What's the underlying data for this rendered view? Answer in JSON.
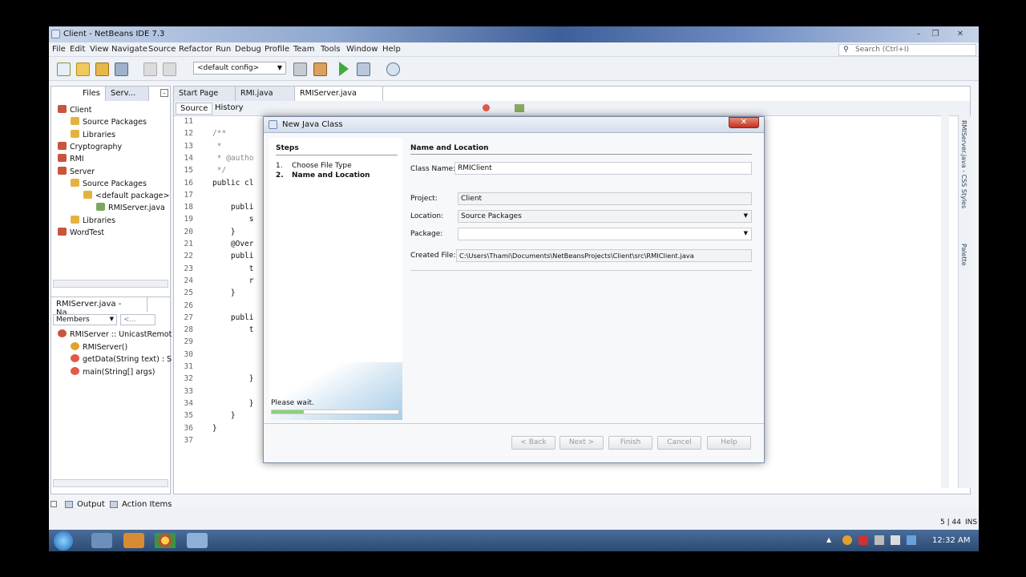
{
  "window": {
    "title": "Client - NetBeans IDE 7.3",
    "search_placeholder": "Search (Ctrl+I)"
  },
  "menu": [
    "File",
    "Edit",
    "View",
    "Navigate",
    "Source",
    "Refactor",
    "Run",
    "Debug",
    "Profile",
    "Team",
    "Tools",
    "Window",
    "Help"
  ],
  "toolbar": {
    "config": "<default config>"
  },
  "projects_panel": {
    "tabs": [
      "Files",
      "Serv..."
    ],
    "tree": [
      {
        "label": "Client",
        "depth": 0
      },
      {
        "label": "Source Packages",
        "depth": 1
      },
      {
        "label": "Libraries",
        "depth": 1
      },
      {
        "label": "Cryptography",
        "depth": 0
      },
      {
        "label": "RMI",
        "depth": 0
      },
      {
        "label": "Server",
        "depth": 0
      },
      {
        "label": "Source Packages",
        "depth": 1
      },
      {
        "label": "<default package>",
        "depth": 2
      },
      {
        "label": "RMIServer.java",
        "depth": 3
      },
      {
        "label": "Libraries",
        "depth": 1
      },
      {
        "label": "WordTest",
        "depth": 0
      }
    ]
  },
  "navigator": {
    "title": "RMIServer.java - Na...",
    "filter": "Members",
    "filter2": "<...",
    "items": [
      "RMIServer :: UnicastRemot",
      "RMIServer()",
      "getData(String text) : S",
      "main(String[] args)"
    ]
  },
  "editor": {
    "tabs": [
      "Start Page",
      "RMI.java",
      "RMIServer.java"
    ],
    "subtabs": [
      "Source",
      "History"
    ],
    "lines": [
      {
        "n": "11",
        "code": ""
      },
      {
        "n": "12",
        "code": "/**"
      },
      {
        "n": "13",
        "code": " *"
      },
      {
        "n": "14",
        "code": " * @autho"
      },
      {
        "n": "15",
        "code": " */"
      },
      {
        "n": "16",
        "code": "public cl"
      },
      {
        "n": "17",
        "code": ""
      },
      {
        "n": "18",
        "code": "    publi"
      },
      {
        "n": "19",
        "code": "        s"
      },
      {
        "n": "20",
        "code": "    }"
      },
      {
        "n": "21",
        "code": "    @Over"
      },
      {
        "n": "22",
        "code": "    publi"
      },
      {
        "n": "23",
        "code": "        t"
      },
      {
        "n": "24",
        "code": "        r"
      },
      {
        "n": "25",
        "code": "    }"
      },
      {
        "n": "26",
        "code": ""
      },
      {
        "n": "27",
        "code": "    publi"
      },
      {
        "n": "28",
        "code": "        t"
      },
      {
        "n": "29",
        "code": ""
      },
      {
        "n": "30",
        "code": ""
      },
      {
        "n": "31",
        "code": ""
      },
      {
        "n": "32",
        "code": "        }"
      },
      {
        "n": "33",
        "code": ""
      },
      {
        "n": "34",
        "code": "        }"
      },
      {
        "n": "35",
        "code": "    }"
      },
      {
        "n": "36",
        "code": "}"
      },
      {
        "n": "37",
        "code": ""
      }
    ]
  },
  "dialog": {
    "title": "New Java Class",
    "steps_heading": "Steps",
    "step1_num": "1.",
    "step1": "Choose File Type",
    "step2_num": "2.",
    "step2": "Name and Location",
    "section": "Name and Location",
    "class_name_label": "Class Name:",
    "class_name": "RMIClient",
    "project_label": "Project:",
    "project": "Client",
    "location_label": "Location:",
    "location": "Source Packages",
    "package_label": "Package:",
    "package": "",
    "created_file_label": "Created File:",
    "created_file": "C:\\Users\\Thami\\Documents\\NetBeansProjects\\Client\\src\\RMIClient.java",
    "wait": "Please wait.",
    "buttons": {
      "back": "< Back",
      "next": "Next >",
      "finish": "Finish",
      "cancel": "Cancel",
      "help": "Help"
    }
  },
  "bottom": {
    "output": "Output",
    "action_items": "Action Items",
    "position": "5 | 44",
    "mode": "INS"
  },
  "right_rail": [
    "RMIServer.java - CSS Styles",
    "Palette"
  ],
  "taskbar": {
    "clock": "12:32 AM"
  }
}
